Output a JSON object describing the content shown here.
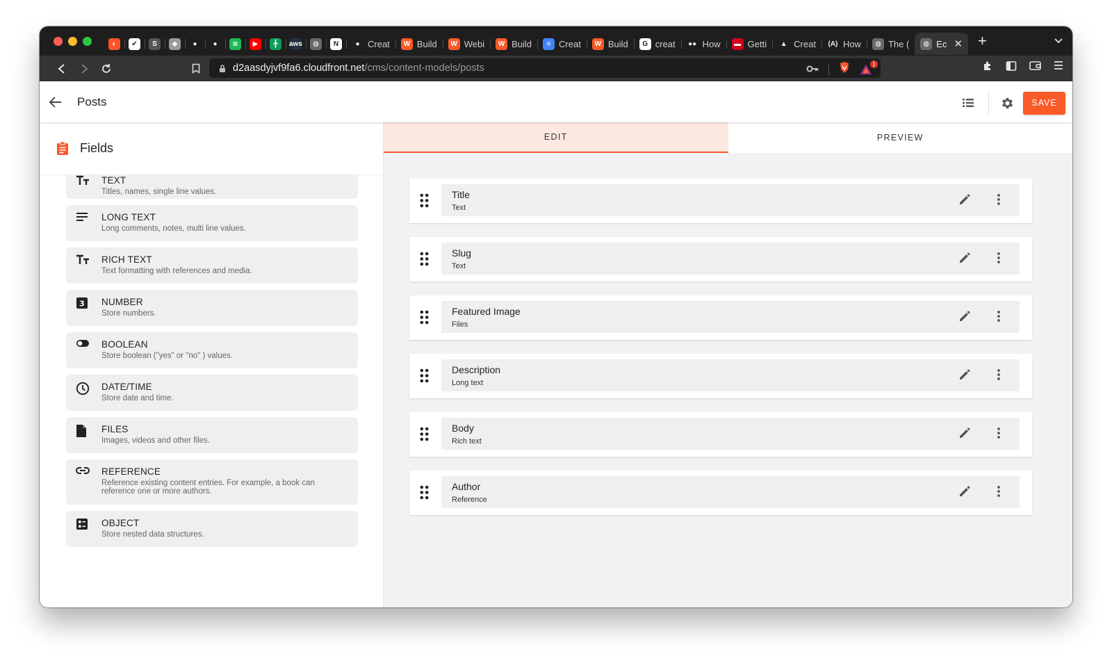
{
  "browser": {
    "traffic_lights": [
      "#fe5f57",
      "#febc2e",
      "#28c840"
    ],
    "tabs": [
      {
        "title": "",
        "icon": "brave-icon",
        "color": "#fb542b",
        "glyph": "◐"
      },
      {
        "title": "",
        "icon": "todo-check-icon",
        "color": "#ffffff",
        "glyph": "✔"
      },
      {
        "title": "",
        "icon": "s-icon",
        "color": "#555555",
        "glyph": "S"
      },
      {
        "title": "",
        "icon": "apple-icon",
        "color": "#9a9a9a",
        "glyph": "◆"
      },
      {
        "title": "",
        "icon": "github-icon",
        "color": "#1e1e1f",
        "glyph": "●"
      },
      {
        "title": "",
        "icon": "github-icon",
        "color": "#1e1e1f",
        "glyph": "●"
      },
      {
        "title": "",
        "icon": "spotify-icon",
        "color": "#1db954",
        "glyph": "≋"
      },
      {
        "title": "",
        "icon": "youtube-icon",
        "color": "#ff0000",
        "glyph": "▶"
      },
      {
        "title": "",
        "icon": "sheets-icon",
        "color": "#0f9d58",
        "glyph": "╋"
      },
      {
        "title": "",
        "icon": "aws-icon",
        "color": "#232f3e",
        "glyph": "aws"
      },
      {
        "title": "",
        "icon": "globe-icon",
        "color": "#6a6a6a",
        "glyph": "◍"
      },
      {
        "title": "",
        "icon": "notion-icon",
        "color": "#ffffff",
        "glyph": "N"
      },
      {
        "title": "Creat",
        "icon": "github-icon",
        "color": "#1e1e1f",
        "glyph": "●"
      },
      {
        "title": "Build",
        "icon": "webiny-icon",
        "color": "#fa5a28",
        "glyph": "W"
      },
      {
        "title": "Webi",
        "icon": "webiny-icon",
        "color": "#fa5a28",
        "glyph": "W"
      },
      {
        "title": "Build",
        "icon": "webiny-icon",
        "color": "#fa5a28",
        "glyph": "W"
      },
      {
        "title": "Creat",
        "icon": "docs-icon",
        "color": "#4285f4",
        "glyph": "≡"
      },
      {
        "title": "Build",
        "icon": "webiny-icon",
        "color": "#fa5a28",
        "glyph": "W"
      },
      {
        "title": "creat",
        "icon": "google-icon",
        "color": "#ffffff",
        "glyph": "G"
      },
      {
        "title": "How",
        "icon": "medium-icon",
        "color": "#1e1e1f",
        "glyph": "●●"
      },
      {
        "title": "Getti",
        "icon": "hub-icon",
        "color": "#d0021b",
        "glyph": "▬"
      },
      {
        "title": "Creat",
        "icon": "gatsby-icon",
        "color": "#1e1e1f",
        "glyph": "▲"
      },
      {
        "title": "How",
        "icon": "a-icon",
        "color": "#1e1e1f",
        "glyph": "(A)"
      },
      {
        "title": "The (",
        "icon": "globe-icon",
        "color": "#6a6a6a",
        "glyph": "◍"
      },
      {
        "title": "Ec",
        "icon": "globe-icon",
        "color": "#6a6a6a",
        "glyph": "◍",
        "active": true
      }
    ],
    "url_host": "d2aasdyjvf9fa6.cloudfront.net",
    "url_path": "/cms/content-models/posts",
    "notification_count": "1"
  },
  "header": {
    "title": "Posts",
    "save_label": "SAVE"
  },
  "sidebar": {
    "title": "Fields",
    "field_types": [
      {
        "name": "TEXT",
        "description": "Titles, names, single line values.",
        "icon": "text-type-icon"
      },
      {
        "name": "LONG TEXT",
        "description": "Long comments, notes, multi line values.",
        "icon": "long-text-icon"
      },
      {
        "name": "RICH TEXT",
        "description": "Text formatting with references and media.",
        "icon": "rich-text-icon"
      },
      {
        "name": "NUMBER",
        "description": "Store numbers.",
        "icon": "number-icon"
      },
      {
        "name": "BOOLEAN",
        "description": "Store boolean (\"yes\" or \"no\" ) values.",
        "icon": "toggle-icon"
      },
      {
        "name": "DATE/TIME",
        "description": "Store date and time.",
        "icon": "clock-icon"
      },
      {
        "name": "FILES",
        "description": "Images, videos and other files.",
        "icon": "file-icon"
      },
      {
        "name": "REFERENCE",
        "description": "Reference existing content entries. For example, a book can reference one or more authors.",
        "icon": "link-icon"
      },
      {
        "name": "OBJECT",
        "description": "Store nested data structures.",
        "icon": "object-icon"
      }
    ]
  },
  "editor": {
    "tabs": {
      "edit": "EDIT",
      "preview": "PREVIEW"
    },
    "fields": [
      {
        "name": "Title",
        "type": "Text"
      },
      {
        "name": "Slug",
        "type": "Text"
      },
      {
        "name": "Featured Image",
        "type": "Files"
      },
      {
        "name": "Description",
        "type": "Long text"
      },
      {
        "name": "Body",
        "type": "Rich text"
      },
      {
        "name": "Author",
        "type": "Reference"
      }
    ]
  },
  "colors": {
    "accent": "#fa5a28",
    "tab_active_bg": "#fde8e1"
  }
}
